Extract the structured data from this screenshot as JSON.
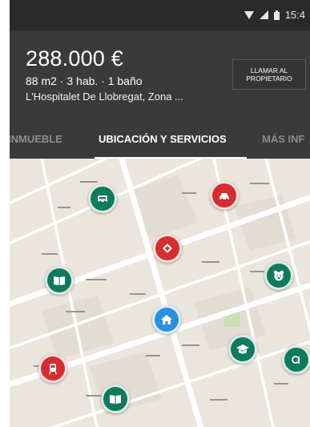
{
  "status_bar": {
    "time": "15:4"
  },
  "listing": {
    "price": "288.000 €",
    "summary": "88 m2 · 3 hab. · 1 baño",
    "address": "L'Hospitalet De Llobregat, Zona ...",
    "call_button": "LLAMAR AL PROPIETARIO"
  },
  "tabs": [
    {
      "label": "INMUEBLE",
      "active": false
    },
    {
      "label": "UBICACIÓN Y SERVICIOS",
      "active": true
    },
    {
      "label": "MÁS INF",
      "active": false
    }
  ],
  "map": {
    "pins": [
      {
        "kind": "bus-stop",
        "icon": "bus-icon",
        "color": "#0f7a5c"
      },
      {
        "kind": "taxi",
        "icon": "taxi-icon",
        "color": "#d62d2d"
      },
      {
        "kind": "metro",
        "icon": "metro-icon",
        "color": "#d62d2d"
      },
      {
        "kind": "library",
        "icon": "book-icon",
        "color": "#0f7a5c"
      },
      {
        "kind": "nursery",
        "icon": "bear-icon",
        "color": "#0f7a5c"
      },
      {
        "kind": "property",
        "icon": "home-icon",
        "color": "#2c8fe0"
      },
      {
        "kind": "university",
        "icon": "graduation-cap-icon",
        "color": "#0f7a5c"
      },
      {
        "kind": "school",
        "icon": "letter-a-icon",
        "color": "#0f7a5c"
      },
      {
        "kind": "train",
        "icon": "train-icon",
        "color": "#d62d2d"
      },
      {
        "kind": "library",
        "icon": "book-icon",
        "color": "#0f7a5c"
      }
    ]
  }
}
